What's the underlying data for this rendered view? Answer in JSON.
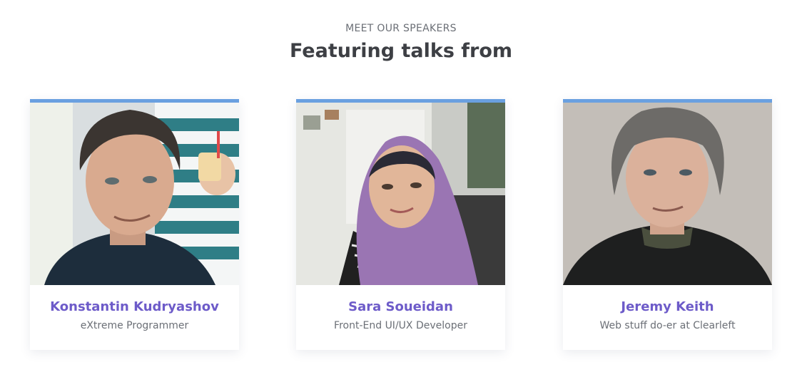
{
  "section": {
    "eyebrow": "MEET OUR SPEAKERS",
    "heading": "Featuring talks from"
  },
  "speakers": [
    {
      "name": "Konstantin Kudryashov",
      "role": "eXtreme Programmer",
      "photo": "speaker-photo"
    },
    {
      "name": "Sara Soueidan",
      "role": "Front-End UI/UX Developer",
      "photo": "speaker-photo"
    },
    {
      "name": "Jeremy Keith",
      "role": "Web stuff do-er at Clearleft",
      "photo": "speaker-photo"
    }
  ],
  "colors": {
    "accent_bar": "#6aa0e0",
    "name_link": "#6d5bc9",
    "heading": "#3d3f44",
    "muted": "#6b6f76"
  }
}
